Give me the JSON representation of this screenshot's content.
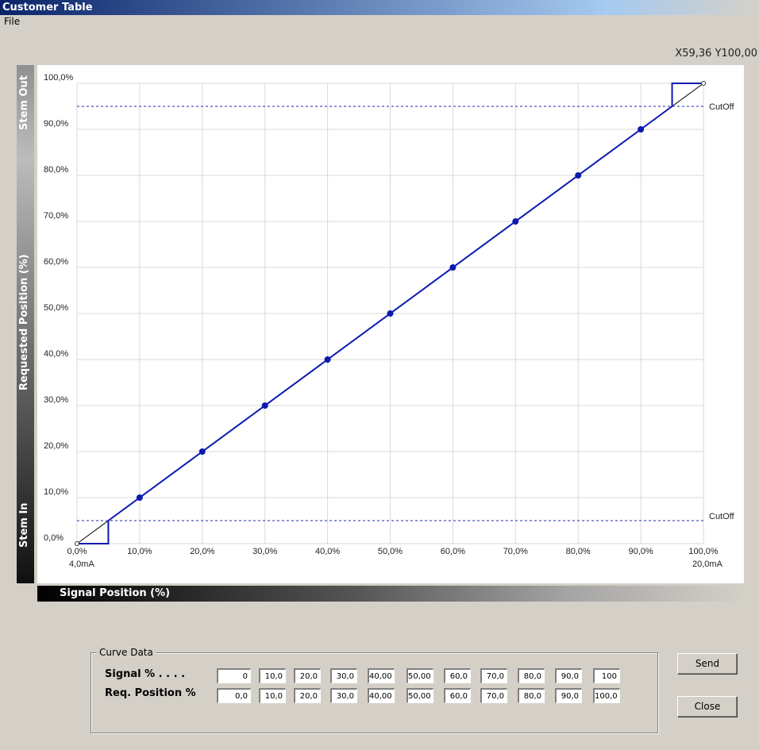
{
  "window": {
    "title": "Customer Table"
  },
  "menu": {
    "file": "File"
  },
  "coords": "X59,36  Y100,00",
  "labels": {
    "stem_out": "Stem Out",
    "requested_position": "Requested Position (%)",
    "stem_in": "Stem In",
    "signal_position": "Signal Position (%)",
    "cutoff_top": "CutOff",
    "cutoff_bottom": "CutOff",
    "ma_low": "4,0mA",
    "ma_high": "20,0mA"
  },
  "chart_data": {
    "type": "line",
    "xlabel": "Signal Position (%)",
    "ylabel": "Requested Position (%)",
    "x_ticks": [
      "0,0%",
      "10,0%",
      "20,0%",
      "30,0%",
      "40,0%",
      "50,0%",
      "60,0%",
      "70,0%",
      "80,0%",
      "90,0%",
      "100,0%"
    ],
    "y_ticks": [
      "0,0%",
      "10,0%",
      "20,0%",
      "30,0%",
      "40,0%",
      "50,0%",
      "60,0%",
      "70,0%",
      "80,0%",
      "90,0%",
      "100,0%"
    ],
    "xlim": [
      0,
      100
    ],
    "ylim": [
      0,
      100
    ],
    "cutoff_low": 5,
    "cutoff_high": 95,
    "reference_line": [
      [
        0,
        0
      ],
      [
        100,
        100
      ]
    ],
    "curve_x": [
      0,
      10,
      20,
      30,
      40,
      50,
      60,
      70,
      80,
      90,
      100
    ],
    "curve_y": [
      0,
      10,
      20,
      30,
      40,
      50,
      60,
      70,
      80,
      90,
      100
    ],
    "grid": true,
    "colors": {
      "curve": "#0c1ab0",
      "cutoff": "#1f2aa8",
      "grid": "#d9d9d9",
      "reference": "#000000"
    }
  },
  "curve_data": {
    "title": "Curve Data",
    "signal_label": "Signal % . . . .",
    "position_label": "Req. Position %",
    "signal_values": [
      "0",
      "10,0",
      "20,0",
      "30,0",
      "40,00",
      "50,00",
      "60,0",
      "70,0",
      "80,0",
      "90,0",
      "100"
    ],
    "position_values": [
      "0,0",
      "10,0",
      "20,0",
      "30,0",
      "40,00",
      "50,00",
      "60,0",
      "70,0",
      "80,0",
      "90,0",
      "100,0"
    ]
  },
  "buttons": {
    "send": "Send",
    "close": "Close"
  }
}
